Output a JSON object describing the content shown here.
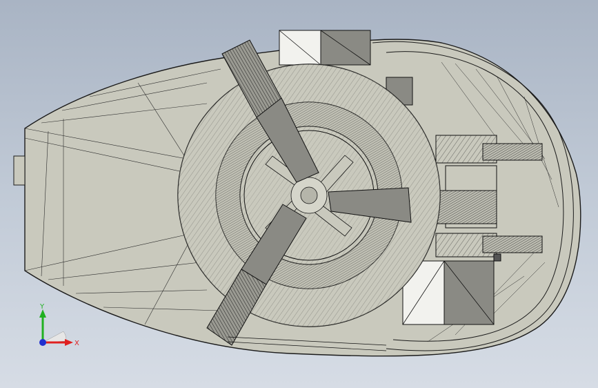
{
  "viewport": {
    "background_top": "#a9b4c4",
    "background_bottom": "#d6dce5"
  },
  "model": {
    "face_color": "#c9c9bd",
    "edge_color": "#1a1a1a",
    "dark_face": "#8a8a84",
    "light_face": "#f2f2ee"
  },
  "triad": {
    "x_label": "X",
    "y_label": "Y",
    "x_color": "#e02020",
    "y_color": "#20b020",
    "z_color": "#2030d0"
  }
}
